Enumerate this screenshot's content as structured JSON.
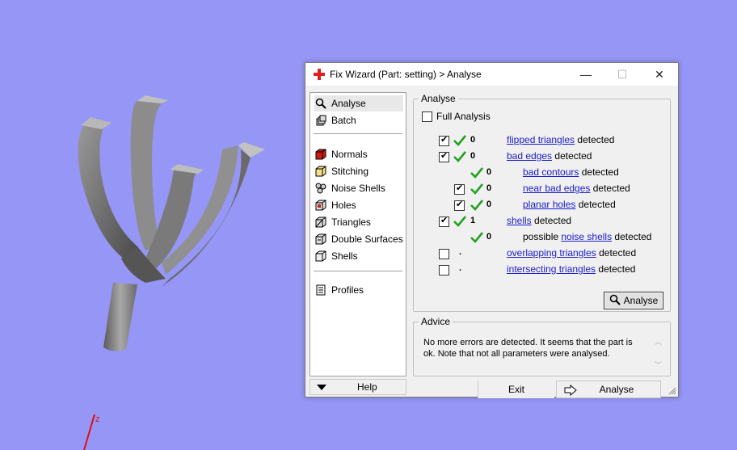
{
  "viewport": {
    "axis_label": "z",
    "background_color": "#9596f5"
  },
  "window": {
    "title": "Fix Wizard (Part: setting) > Analyse",
    "buttons": {
      "minimize": "—",
      "maximize": "☐",
      "close": "✕"
    }
  },
  "nav": {
    "items_top": [
      {
        "label": "Analyse",
        "icon": "magnifier-icon"
      },
      {
        "label": "Batch",
        "icon": "batch-icon"
      }
    ],
    "items_mid": [
      {
        "label": "Normals",
        "icon": "normals-cube-icon"
      },
      {
        "label": "Stitching",
        "icon": "stitching-cube-icon"
      },
      {
        "label": "Noise Shells",
        "icon": "noise-shells-icon"
      },
      {
        "label": "Holes",
        "icon": "holes-cube-icon"
      },
      {
        "label": "Triangles",
        "icon": "triangles-cube-icon"
      },
      {
        "label": "Double Surfaces",
        "icon": "double-surfaces-icon"
      },
      {
        "label": "Shells",
        "icon": "shells-icon"
      }
    ],
    "items_bottom": [
      {
        "label": "Profiles",
        "icon": "profiles-icon"
      }
    ],
    "help": "Help"
  },
  "analyse": {
    "group_label": "Analyse",
    "full_analysis": "Full Analysis",
    "rows": [
      {
        "count": "0",
        "link": "flipped triangles",
        "suffix": "detected",
        "prefix": ""
      },
      {
        "count": "0",
        "link": "bad edges",
        "suffix": "detected",
        "prefix": ""
      },
      {
        "count": "0",
        "link": "bad contours",
        "suffix": "detected",
        "prefix": ""
      },
      {
        "count": "0",
        "link": "near bad edges",
        "suffix": "detected",
        "prefix": ""
      },
      {
        "count": "0",
        "link": "planar holes",
        "suffix": "detected",
        "prefix": ""
      },
      {
        "count": "1",
        "link": "shells",
        "suffix": "detected",
        "prefix": ""
      },
      {
        "count": "0",
        "link": "noise shells",
        "suffix": "detected",
        "prefix": "possible"
      },
      {
        "count": ".",
        "link": "overlapping triangles",
        "suffix": "detected",
        "prefix": ""
      },
      {
        "count": ".",
        "link": "intersecting triangles",
        "suffix": "detected",
        "prefix": ""
      }
    ],
    "button": "Analyse"
  },
  "advice": {
    "group_label": "Advice",
    "text": "No more errors are detected. It seems that the part is ok. Note that not all parameters were analysed."
  },
  "footer": {
    "exit": "Exit",
    "analyse": "Analyse"
  }
}
